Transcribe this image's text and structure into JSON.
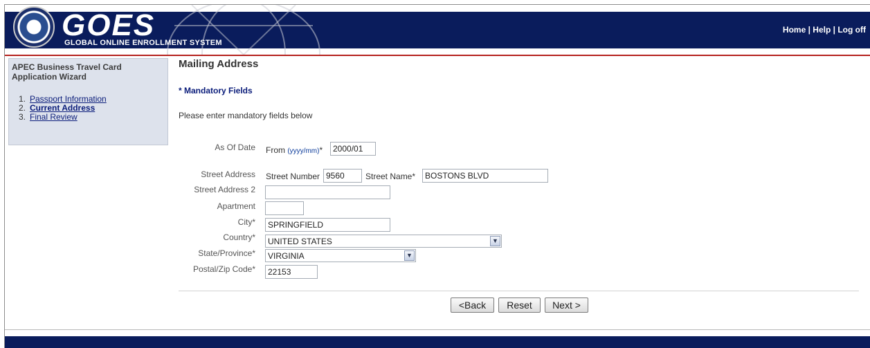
{
  "header": {
    "logo_title": "GOES",
    "logo_subtitle": "GLOBAL ONLINE ENROLLMENT SYSTEM",
    "links": [
      "Home",
      "Help",
      "Log off"
    ],
    "separator": " | ",
    "colors": {
      "navy": "#0a1c5c",
      "accent_red": "#b5201c"
    }
  },
  "sidebar": {
    "title": "APEC Business Travel Card Application Wizard",
    "items": [
      {
        "number": "1.",
        "label": "Passport Information",
        "current": false
      },
      {
        "number": "2.",
        "label": "Current Address",
        "current": true
      },
      {
        "number": "3.",
        "label": "Final Review",
        "current": false
      }
    ]
  },
  "main": {
    "page_title": "Mailing Address",
    "mandatory_note": "* Mandatory Fields",
    "instructions": "Please enter mandatory fields below",
    "as_of_date": {
      "label": "As Of Date",
      "from_label": "From",
      "format_hint": "(yyyy/mm)",
      "required_mark": "*",
      "value": "2000/01"
    },
    "street_address": {
      "label": "Street Address",
      "number_label": "Street Number",
      "number_value": "9560",
      "name_label": "Street Name*",
      "name_value": "BOSTONS BLVD"
    },
    "street_address_2": {
      "label": "Street Address 2",
      "value": ""
    },
    "apartment": {
      "label": "Apartment",
      "value": ""
    },
    "city": {
      "label": "City*",
      "value": "SPRINGFIELD"
    },
    "country": {
      "label": "Country*",
      "value": "UNITED STATES"
    },
    "state": {
      "label": "State/Province*",
      "value": "VIRGINIA"
    },
    "postal": {
      "label": "Postal/Zip Code*",
      "value": "22153"
    },
    "buttons": {
      "back": "<Back",
      "reset": "Reset",
      "next": "Next >"
    }
  }
}
